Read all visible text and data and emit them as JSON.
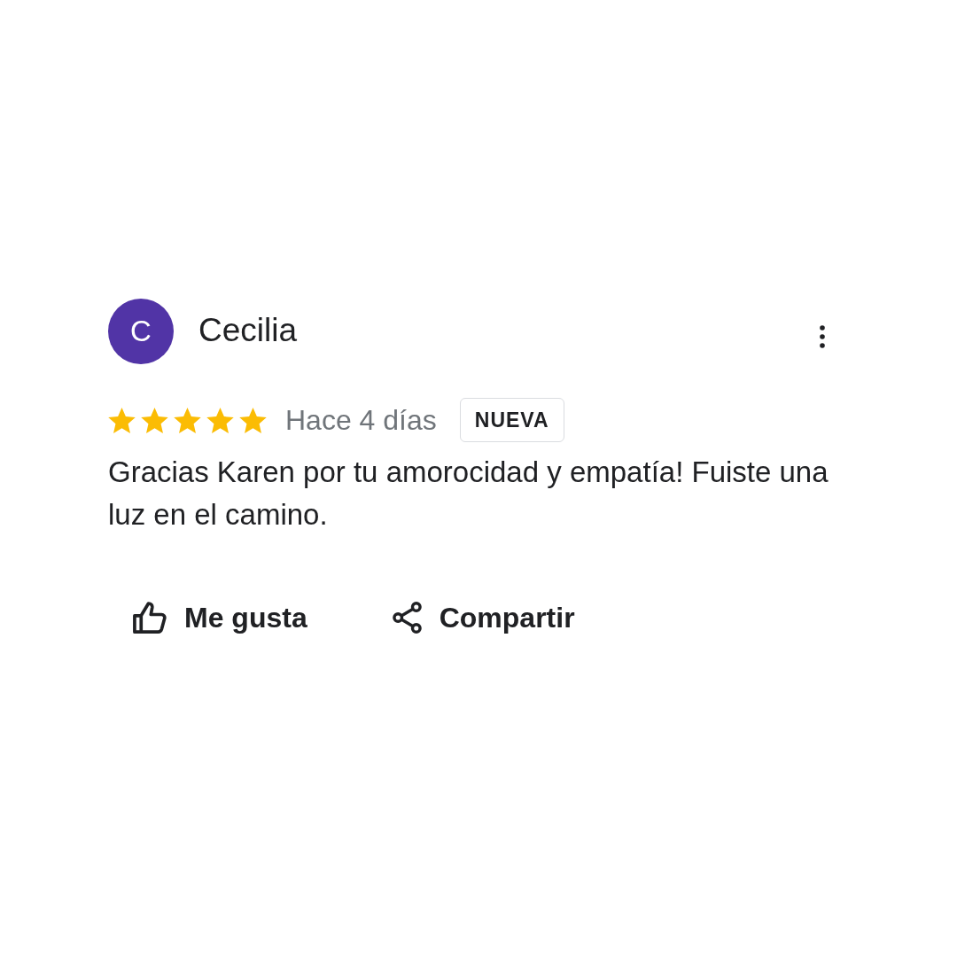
{
  "review": {
    "author": {
      "initial": "C",
      "name": "Cecilia"
    },
    "stars": 5,
    "time": "Hace 4 días",
    "badge": "NUEVA",
    "text": "Gracias Karen por tu amorocidad y empatía! Fuiste una luz en el camino.",
    "actions": [
      {
        "kind": "like",
        "label": "Me gusta"
      },
      {
        "kind": "share",
        "label": "Compartir"
      }
    ]
  }
}
